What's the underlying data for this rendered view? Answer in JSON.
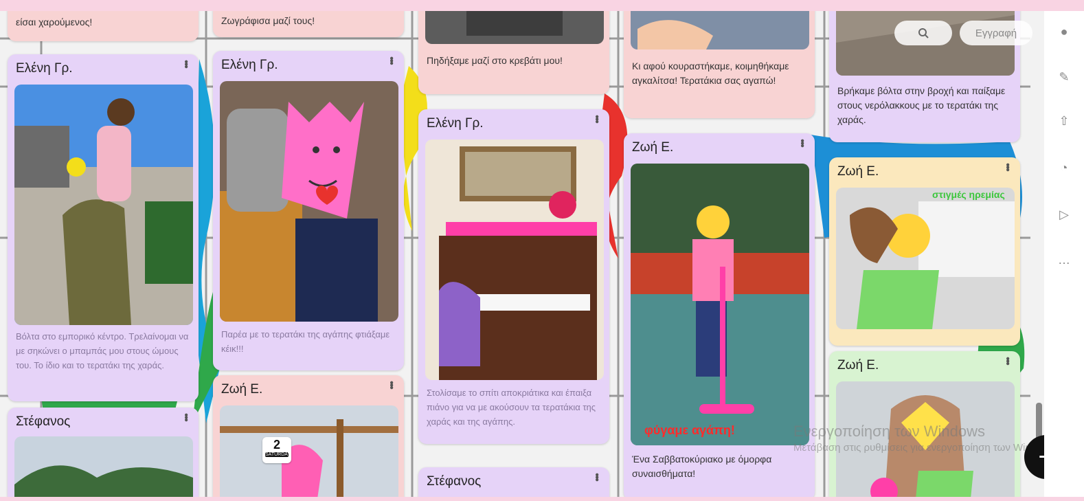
{
  "toolbar": {
    "search_icon": "search-icon",
    "signup_label": "Εγγραφή"
  },
  "fab": {
    "label": "+"
  },
  "watermark": {
    "line1": "Ενεργοποίηση των Windows",
    "line2": "Μετάβαση στις ρυθμίσεις για ενεργοποίηση των Windows."
  },
  "columns": [
    {
      "cards": [
        {
          "caption": "είσαι χαρούμενος!"
        },
        {
          "author": "Ελένη Γρ.",
          "caption": "Βόλτα στο εμπορικό κέντρο. Τρελαίνομαι να με σηκώνει ο μπαμπάς μου στους ώμους του. Το ίδιο και το τερατάκι της χαράς."
        },
        {
          "author": "Στέφανος"
        }
      ]
    },
    {
      "cards": [
        {
          "caption": "Ζωγράφισα μαζί τους!"
        },
        {
          "author": "Ελένη Γρ.",
          "caption": "Παρέα με το τερατάκι της αγάπης φτιάξαμε κέικ!!!"
        },
        {
          "author": "Ζωή Ε.",
          "badge_num": "2",
          "badge_day": "SATURDAY"
        }
      ]
    },
    {
      "cards": [
        {
          "caption": "Πηδήξαμε μαζί στο κρεβάτι μου!"
        },
        {
          "author": "Ελένη Γρ.",
          "caption": "Στολίσαμε το σπίτι αποκριάτικα και έπαιξα πιάνο για να με ακούσουν τα τερατάκια της χαράς και της αγάπης."
        },
        {
          "author": "Στέφανος"
        }
      ]
    },
    {
      "cards": [
        {
          "caption": "Κι αφού κουραστήκαμε, κοιμηθήκαμε αγκαλίτσα! Τερατάκια σας αγαπώ!"
        },
        {
          "author": "Ζωή Ε.",
          "overlay": "φύγαμε αγάπη!",
          "caption": "Ένα Σαββατοκύριακο με όμορφα συναισθήματα!"
        }
      ]
    },
    {
      "cards": [
        {
          "caption": "Βρήκαμε βόλτα στην βροχή και παίξαμε στους νερόλακκους με το τερατάκι της χαράς."
        },
        {
          "author": "Ζωή Ε.",
          "overlay": "στιγμές ηρεμίας"
        },
        {
          "author": "Ζωή Ε."
        }
      ]
    }
  ]
}
